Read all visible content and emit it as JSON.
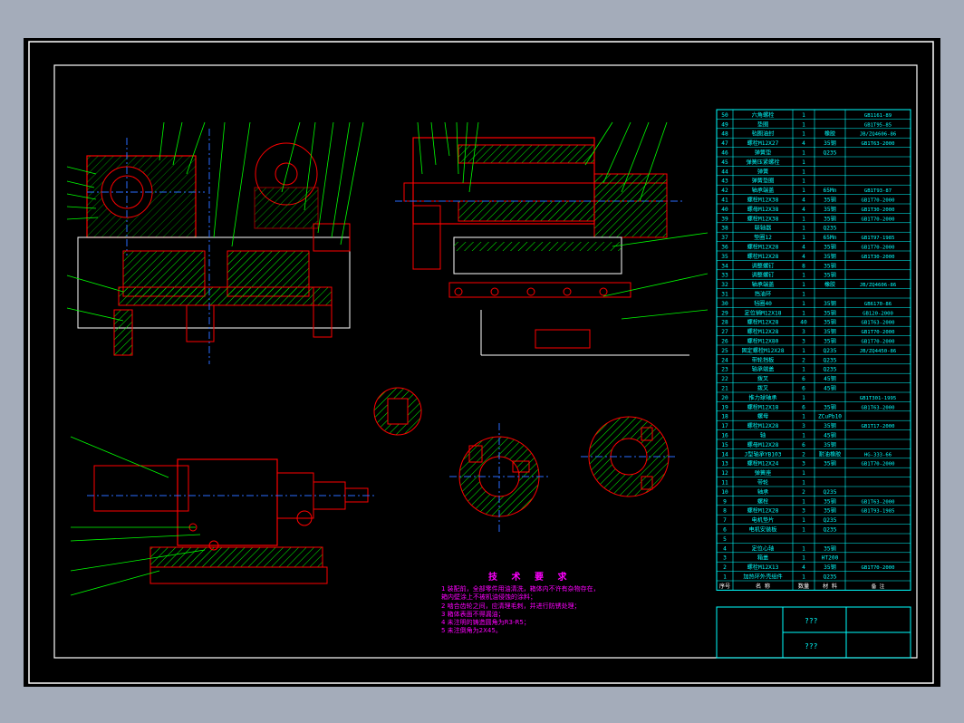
{
  "drawing": {
    "title_block": {
      "name": "???",
      "code": "???"
    },
    "bom": {
      "headers": [
        "序号",
        "名 称",
        "数量",
        "材 料",
        "备 注"
      ],
      "rows": [
        [
          "50",
          "六角螺栓",
          "1",
          "",
          "GB1161-89"
        ],
        [
          "49",
          "垫圈",
          "1",
          "",
          "GB1T95-85"
        ],
        [
          "48",
          "毡圈油封",
          "1",
          "橡胶",
          "JB/ZQ4606-86"
        ],
        [
          "47",
          "螺栓M12X27",
          "4",
          "35钢",
          "GB1T63-2000"
        ],
        [
          "46",
          "弹簧垫",
          "1",
          "Q235",
          ""
        ],
        [
          "45",
          "弹簧压紧螺栓",
          "1",
          "",
          ""
        ],
        [
          "44",
          "弹簧",
          "1",
          "",
          ""
        ],
        [
          "43",
          "弹簧垫圈",
          "1",
          "",
          ""
        ],
        [
          "42",
          "轴承端盖",
          "1",
          "65Mn",
          "GB1T93-87"
        ],
        [
          "41",
          "螺栓M12X38",
          "4",
          "35钢",
          "GB1T70-2000"
        ],
        [
          "40",
          "螺母M12X38",
          "4",
          "35钢",
          "GB1T30-2000"
        ],
        [
          "39",
          "螺栓M12X38",
          "1",
          "35钢",
          "GB1T70-2000"
        ],
        [
          "38",
          "联轴器",
          "1",
          "Q235",
          ""
        ],
        [
          "37",
          "垫圈12",
          "1",
          "65Mn",
          "GB1T97-1985"
        ],
        [
          "36",
          "螺栓M12X28",
          "4",
          "35钢",
          "GB1T70-2000"
        ],
        [
          "35",
          "螺栓M12X28",
          "4",
          "35钢",
          "GB1T30-2000"
        ],
        [
          "34",
          "调整螺钉",
          "8",
          "35钢",
          ""
        ],
        [
          "33",
          "调整螺钉",
          "1",
          "35钢",
          ""
        ],
        [
          "32",
          "轴承端盖",
          "1",
          "橡胶",
          "JB/ZQ4606-86"
        ],
        [
          "31",
          "挡油环",
          "1",
          "",
          ""
        ],
        [
          "30",
          "毡圈40",
          "1",
          "35钢",
          "GB6170-86"
        ],
        [
          "29",
          "定位销M12X18",
          "1",
          "35钢",
          "GB120-2000"
        ],
        [
          "28",
          "螺栓M12X28",
          "40",
          "35钢",
          "GB1T63-2000"
        ],
        [
          "27",
          "螺栓M12X28",
          "3",
          "35钢",
          "GB1T70-2000"
        ],
        [
          "26",
          "螺栓M12X80",
          "3",
          "35钢",
          "GB1T70-2000"
        ],
        [
          "25",
          "固定螺栓M12X28",
          "1",
          "Q235",
          "JB/ZQ4450-86"
        ],
        [
          "24",
          "带轮挡板",
          "2",
          "Q235",
          ""
        ],
        [
          "23",
          "轴承端盖",
          "1",
          "Q235",
          ""
        ],
        [
          "22",
          "拨叉",
          "6",
          "45钢",
          ""
        ],
        [
          "21",
          "拨叉",
          "6",
          "45钢",
          ""
        ],
        [
          "20",
          "推力球轴承",
          "1",
          "",
          "GB1T301-1995"
        ],
        [
          "19",
          "螺栓M12X18",
          "6",
          "35钢",
          "GB1T63-2000"
        ],
        [
          "18",
          "螺母",
          "1",
          "ZCuPb10",
          ""
        ],
        [
          "17",
          "螺栓M12X28",
          "3",
          "35钢",
          "GB1T17-2000"
        ],
        [
          "16",
          "轴",
          "1",
          "45钢",
          ""
        ],
        [
          "15",
          "螺母M12X28",
          "6",
          "35钢",
          ""
        ],
        [
          "14",
          "J型轴承YB103",
          "2",
          "耐油橡胶",
          "HG-333-66"
        ],
        [
          "13",
          "螺栓M12X24",
          "3",
          "35钢",
          "GB1T70-2000"
        ],
        [
          "12",
          "弹簧座",
          "1",
          "",
          ""
        ],
        [
          "11",
          "带轮",
          "1",
          "",
          ""
        ],
        [
          "10",
          "轴承",
          "2",
          "Q235",
          ""
        ],
        [
          "9",
          "螺栓",
          "1",
          "35钢",
          "GB1T63-2000"
        ],
        [
          "8",
          "螺栓M12X28",
          "3",
          "35钢",
          "GB1T93-1985"
        ],
        [
          "7",
          "电机垫片",
          "1",
          "Q235",
          ""
        ],
        [
          "6",
          "电机安装板",
          "1",
          "Q235",
          ""
        ],
        [
          "5",
          "",
          "",
          "",
          ""
        ],
        [
          "4",
          "定位心轴",
          "1",
          "35钢",
          ""
        ],
        [
          "3",
          "箱盖",
          "1",
          "HT200",
          ""
        ],
        [
          "2",
          "螺栓M12X13",
          "4",
          "35钢",
          "GB1T70-2000"
        ],
        [
          "1",
          "加热环外壳组件",
          "1",
          "Q235",
          ""
        ]
      ]
    },
    "tech_requirements": {
      "title": "技 术 要 求",
      "items": [
        "1  装配前，全部零件用油清洗，箱体内不许有杂物存在，",
        "   箱内壁涂上不被机油侵蚀的涂料；",
        "2  啮合齿轮之间，应清理毛刺，并进行防锈处理；",
        "3  箱体表面不得漏油；",
        "4  未注明的铸造圆角为R3-R5；",
        "5  未注倒角为2X45。"
      ]
    },
    "colors": {
      "frame": "#ffffff",
      "outline": "#ff0000",
      "hatch": "#00ff00",
      "centerline": "#2a6cff",
      "leader": "#00ff00",
      "bom_border": "#00ffff",
      "bom_text": "#00ffff",
      "notes": "#ff00ff",
      "dims": "#ffffff"
    }
  }
}
